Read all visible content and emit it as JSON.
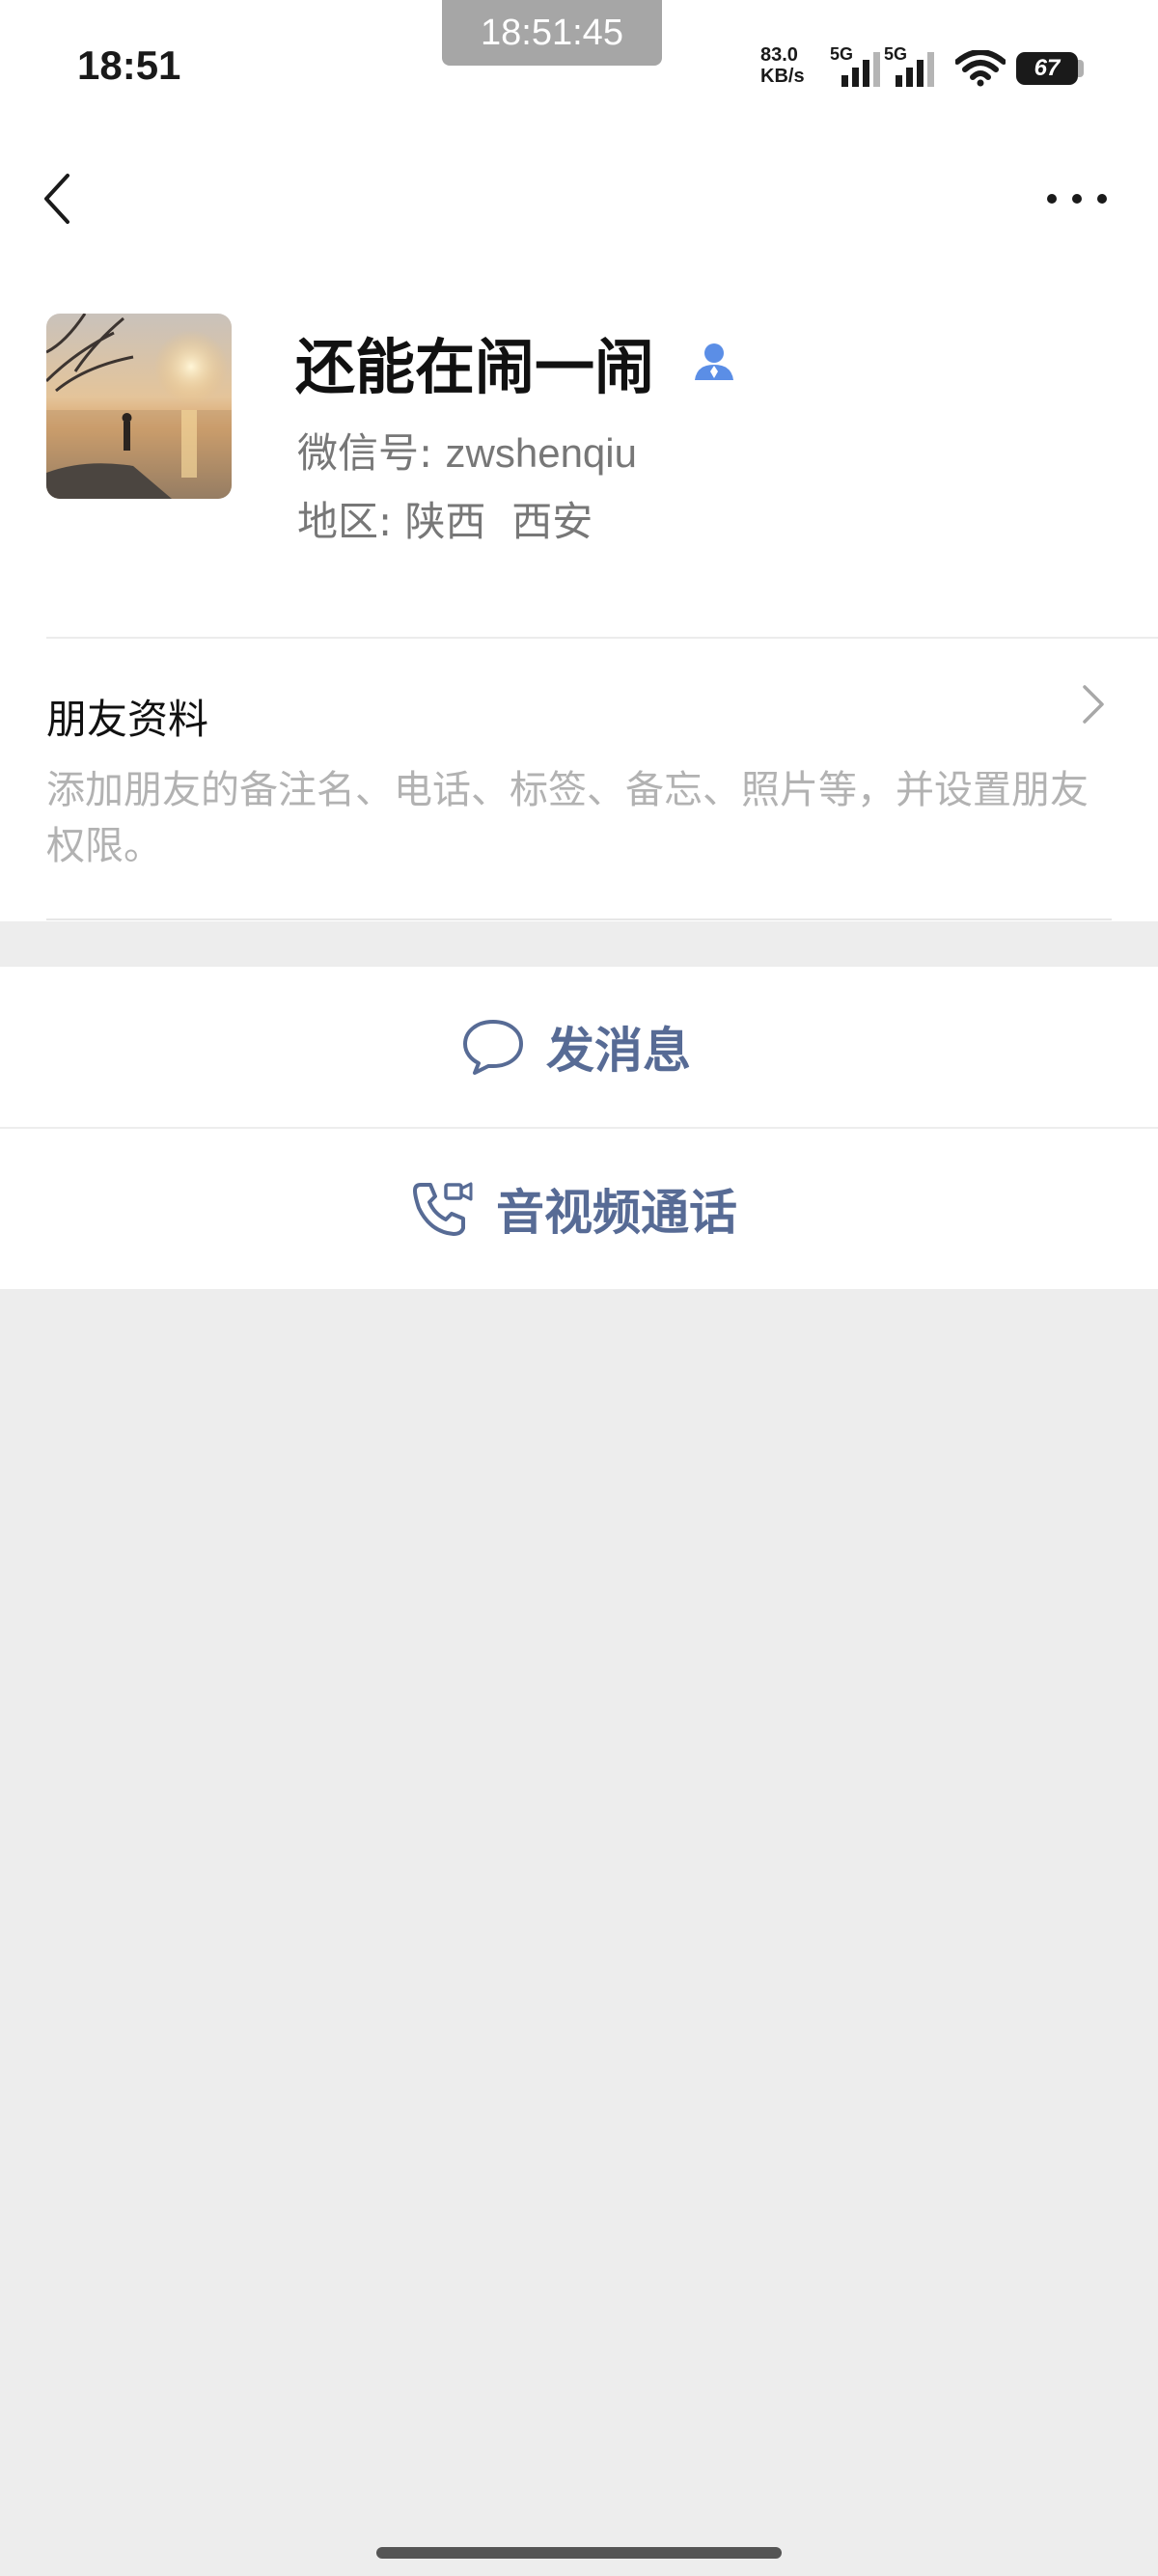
{
  "status_bar": {
    "time": "18:51",
    "recording_time": "18:51:45",
    "net_speed_value": "83.0",
    "net_speed_unit": "KB/s",
    "sim1_label": "5G",
    "sim2_label": "5G",
    "battery": "67"
  },
  "nav": {
    "back_icon": "chevron-left-icon",
    "more_icon": "ellipsis-icon"
  },
  "profile": {
    "name": "还能在闹一闹",
    "wechat_id_label": "微信号:",
    "wechat_id": "zwshenqiu",
    "region_label": "地区:",
    "region_province": "陕西",
    "region_city": "西安",
    "contact_icon": "person-icon"
  },
  "friend_info": {
    "title": "朋友资料",
    "description": "添加朋友的备注名、电话、标签、备忘、照片等，并设置朋友权限。"
  },
  "actions": {
    "message_label": "发消息",
    "message_icon": "chat-bubble-icon",
    "call_label": "音视频通话",
    "call_icon": "phone-video-icon"
  },
  "colors": {
    "action_text": "#576b95",
    "page_bg": "#ededed",
    "contact_icon": "#5b8ee6"
  }
}
